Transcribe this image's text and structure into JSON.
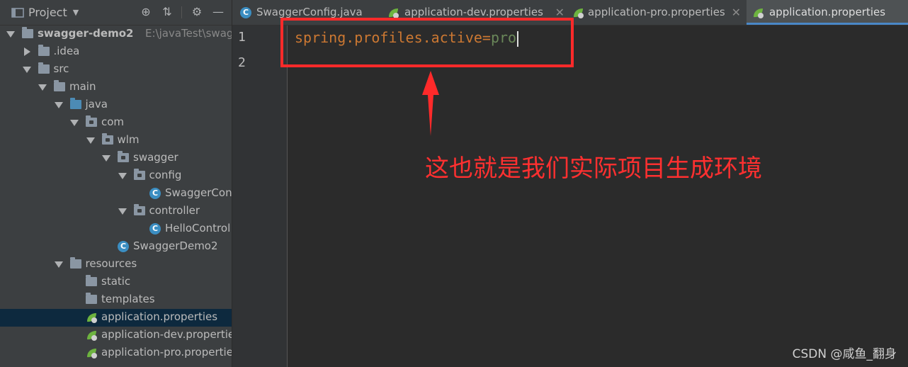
{
  "project_panel": {
    "title": "Project",
    "tree": [
      {
        "label": "swagger-demo2",
        "hint": "E:\\javaTest\\swagger",
        "type": "module",
        "expanded": true
      },
      {
        "label": ".idea",
        "type": "folder",
        "expanded": false
      },
      {
        "label": "src",
        "type": "folder",
        "expanded": true
      },
      {
        "label": "main",
        "type": "folder",
        "expanded": true
      },
      {
        "label": "java",
        "type": "source-folder",
        "expanded": true
      },
      {
        "label": "com",
        "type": "package",
        "expanded": true
      },
      {
        "label": "wlm",
        "type": "package",
        "expanded": true
      },
      {
        "label": "swagger",
        "type": "package",
        "expanded": true
      },
      {
        "label": "config",
        "type": "package",
        "expanded": true
      },
      {
        "label": "SwaggerCon",
        "type": "class"
      },
      {
        "label": "controller",
        "type": "package",
        "expanded": true
      },
      {
        "label": "HelloControl",
        "type": "class"
      },
      {
        "label": "SwaggerDemo2",
        "type": "spring-class"
      },
      {
        "label": "resources",
        "type": "resources-folder",
        "expanded": true
      },
      {
        "label": "static",
        "type": "folder"
      },
      {
        "label": "templates",
        "type": "folder"
      },
      {
        "label": "application.properties",
        "type": "properties",
        "selected": true
      },
      {
        "label": "application-dev.propertie",
        "type": "properties"
      },
      {
        "label": "application-pro.propertie",
        "type": "properties"
      }
    ]
  },
  "tabs": [
    {
      "label": "SwaggerConfig.java",
      "icon": "class-icon",
      "active": false
    },
    {
      "label": "application-dev.properties",
      "icon": "spring-leaf-icon",
      "active": false
    },
    {
      "label": "application-pro.properties",
      "icon": "spring-leaf-icon",
      "active": false
    },
    {
      "label": "application.properties",
      "icon": "spring-leaf-icon",
      "active": true
    }
  ],
  "editor": {
    "line_numbers": [
      "1",
      "2"
    ],
    "line1": {
      "key": "spring.profiles.active",
      "eq": "=",
      "value": "pro"
    }
  },
  "annotation": {
    "text": "这也就是我们实际项目生成环境",
    "color": "#ff2a2a"
  },
  "watermark": "CSDN @咸鱼_翻身",
  "colors": {
    "key": "#cc7832",
    "value": "#6a8759",
    "selection": "#0d293e",
    "accent": "#4a88c7"
  }
}
